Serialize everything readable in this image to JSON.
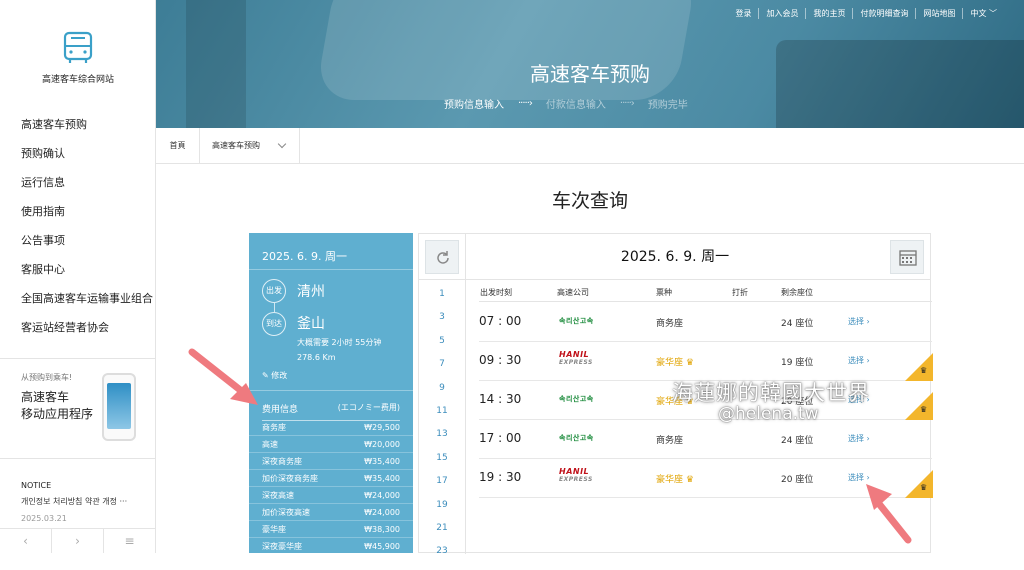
{
  "site": {
    "name": "高速客车综合网站"
  },
  "sidebar": {
    "menu": [
      "高速客车预购",
      "预购确认",
      "运行信息",
      "使用指南",
      "公告事项",
      "客服中心",
      "全国高速客车运输事业组合",
      "客运站经营者协会"
    ],
    "app_promo": {
      "subtitle": "从预购到乘车!",
      "title_line1": "高速客车",
      "title_line2": "移动应用程序"
    },
    "notice": {
      "header": "NOTICE",
      "text": "개인정보 처리방침 약관 개정 ···",
      "date": "2025.03.21"
    },
    "pager": {
      "prev": "‹",
      "next": "›",
      "menu": "≡"
    }
  },
  "topnav": [
    "登录",
    "加入会员",
    "我的主页",
    "付款明细查询",
    "网站地图",
    "中文"
  ],
  "hero": {
    "title": "高速客车预购",
    "steps": [
      "预购信息输入",
      "付款信息输入",
      "预购完毕"
    ]
  },
  "breadcrumb": {
    "home": "首頁",
    "current": "高速客车预购"
  },
  "page_title": "车次查询",
  "trip": {
    "date": "2025. 6. 9. 周一",
    "depart_label": "出发",
    "depart_city": "清州",
    "arrive_label": "到达",
    "arrive_city": "釜山",
    "duration": "大概需要 2小时 55分钟",
    "distance": "278.6 Km",
    "edit": "修改"
  },
  "fares": {
    "header": "费用信息",
    "header_note": "(エコノミー费用)",
    "items": [
      {
        "name": "商务座",
        "price": "₩29,500"
      },
      {
        "name": "高速",
        "price": "₩20,000"
      },
      {
        "name": "深夜商务座",
        "price": "₩35,400"
      },
      {
        "name": "加价深夜商务座",
        "price": "₩35,400"
      },
      {
        "name": "深夜高速",
        "price": "₩24,000"
      },
      {
        "name": "加价深夜高速",
        "price": "₩24,000"
      },
      {
        "name": "豪华座",
        "price": "₩38,300"
      },
      {
        "name": "深夜豪华座",
        "price": "₩45,900"
      }
    ]
  },
  "timetable": {
    "date": "2025. 6. 9. 周一",
    "dates": [
      "1",
      "3",
      "5",
      "7",
      "9",
      "11",
      "13",
      "15",
      "17",
      "19",
      "21",
      "23"
    ],
    "columns": [
      "出发时刻",
      "高速公司",
      "票种",
      "打折",
      "剩余座位"
    ],
    "rows": [
      {
        "time": "07 : 00",
        "company": "속리산고속",
        "grade": "商务座",
        "seats": "24 座位",
        "select": "选择 ›"
      },
      {
        "time": "09 : 30",
        "company": "HANIL",
        "company_sub": "EXPRESS",
        "grade": "豪华座",
        "seats": "19 座位",
        "select": "选择 ›"
      },
      {
        "time": "14 : 30",
        "company": "속리산고속",
        "grade": "豪华座",
        "seats": "20 座位",
        "select": "选择 ›"
      },
      {
        "time": "17 : 00",
        "company": "속리산고속",
        "grade": "商务座",
        "seats": "24 座位",
        "select": "选择 ›"
      },
      {
        "time": "19 : 30",
        "company": "HANIL",
        "company_sub": "EXPRESS",
        "grade": "豪华座",
        "seats": "20 座位",
        "select": "选择 ›"
      }
    ]
  },
  "watermark": {
    "line1": "海蓮娜的韓國大世界",
    "line2": "@helena.tw"
  },
  "colors": {
    "accent": "#5fafd0",
    "hero": "#4b8aa3",
    "link": "#3c8dbc",
    "premium": "#f3b62c"
  }
}
